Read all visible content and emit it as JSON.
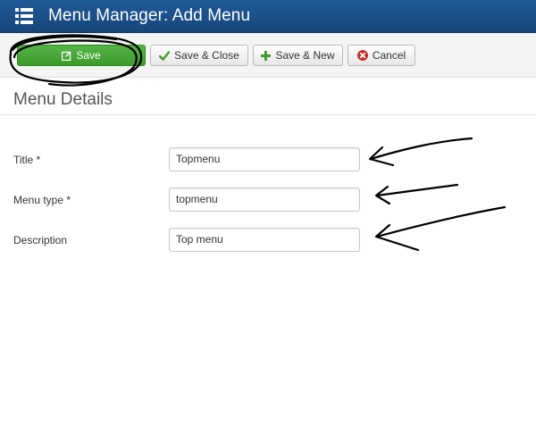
{
  "header": {
    "title": "Menu Manager: Add Menu",
    "background": "#1b4f88",
    "icon": "list-menu-icon"
  },
  "toolbar": {
    "save_label": "Save",
    "save_close_label": "Save & Close",
    "save_new_label": "Save & New",
    "cancel_label": "Cancel",
    "save_color": "#46a536",
    "icons": {
      "save": "edit-icon",
      "save_close": "check-icon",
      "save_new": "plus-icon",
      "cancel": "cancel-circle-icon"
    }
  },
  "section": {
    "title": "Menu Details"
  },
  "form": {
    "title_label": "Title *",
    "title_value": "Topmenu",
    "menu_type_label": "Menu type *",
    "menu_type_value": "topmenu",
    "description_label": "Description",
    "description_value": "Top menu"
  }
}
